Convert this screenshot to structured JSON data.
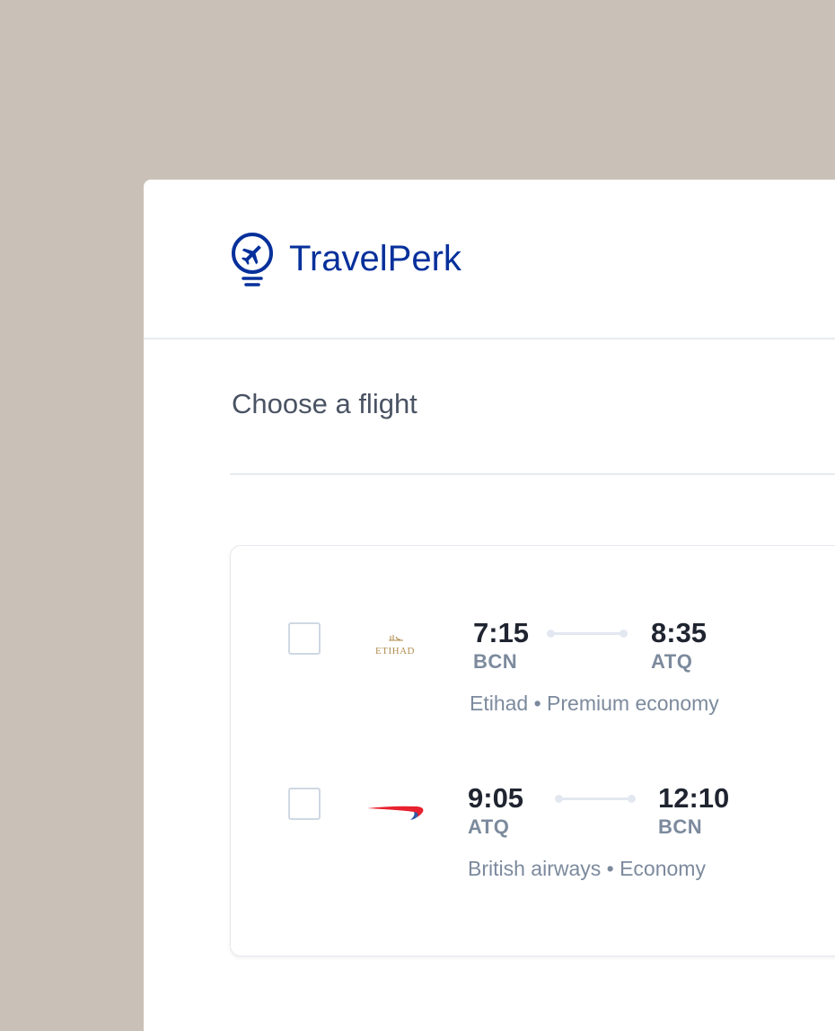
{
  "app": {
    "brand": "TravelPerk",
    "logo_icon": "lightbulb-plane-icon"
  },
  "page": {
    "title": "Choose a flight"
  },
  "flights": [
    {
      "selected": false,
      "airline_logo": "etihad-logo",
      "airline_logo_text": "ETIHAD",
      "departure_time": "7:15",
      "departure_code": "BCN",
      "arrival_time": "8:35",
      "arrival_code": "ATQ",
      "details": "Etihad • Premium economy"
    },
    {
      "selected": false,
      "airline_logo": "british-airways-logo",
      "departure_time": "9:05",
      "departure_code": "ATQ",
      "arrival_time": "12:10",
      "arrival_code": "BCN",
      "details": "British airways • Economy"
    }
  ],
  "colors": {
    "background": "#c9c1b8",
    "brand_blue": "#06309b",
    "etihad_gold": "#b08d4e",
    "ba_red": "#e8212f",
    "ba_blue": "#2d5aa8"
  }
}
